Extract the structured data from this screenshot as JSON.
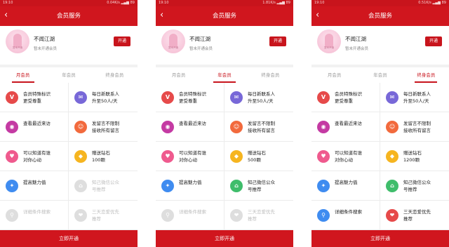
{
  "colors": {
    "brand": "#c8141c",
    "ic_red": "#e64a4a",
    "ic_purple": "#7868d8",
    "ic_magenta": "#c43aa3",
    "ic_orange": "#f26a3d",
    "ic_pink": "#ef5a8e",
    "ic_yellow": "#f6b520",
    "ic_blue": "#3f8cf0",
    "ic_green": "#3fbd6b"
  },
  "screens": [
    {
      "status": {
        "time": "19:10",
        "net": "0.04K/s",
        "battery": "89"
      },
      "title": "会员服务",
      "profile": {
        "name": "不闻江湖",
        "status": "暂未开通会员",
        "open": "开通",
        "avatar_text": "暂未开通"
      },
      "tabs": [
        "月会员",
        "年会员",
        "终身会员"
      ],
      "active_tab": 0,
      "features": [
        {
          "icon": "vip-v-icon",
          "glyph": "V",
          "label": [
            "会员特殊标识",
            "更受尊重"
          ]
        },
        {
          "icon": "mail-icon",
          "glyph": "✉",
          "label": [
            "每日新联系人",
            "升至50人/天"
          ]
        },
        {
          "icon": "eye-icon",
          "glyph": "◉",
          "label": [
            "查看最近来访",
            ""
          ]
        },
        {
          "icon": "message-icon",
          "glyph": "☺",
          "label": [
            "发留言不限制",
            "接收所有留言"
          ]
        },
        {
          "icon": "heart-icon",
          "glyph": "♥",
          "label": [
            "可以知道有谁",
            "对你心动"
          ]
        },
        {
          "icon": "diamond-icon",
          "glyph": "◆",
          "label": [
            "赠送钻石",
            "100颗"
          ]
        },
        {
          "icon": "charm-icon",
          "glyph": "✦",
          "label": [
            "提高魅力值",
            ""
          ]
        },
        {
          "icon": "wechat-icon",
          "glyph": "⌂",
          "label": [
            "知己微信公众",
            "号推荐"
          ]
        },
        {
          "icon": "search-icon",
          "glyph": "⚲",
          "label": [
            "详细条件搜索",
            ""
          ]
        },
        {
          "icon": "love-icon",
          "glyph": "❤",
          "label": [
            "三天恋爱优先",
            "推荐"
          ]
        }
      ],
      "dimmed": [
        7,
        8,
        9
      ],
      "cta": "立即开通"
    },
    {
      "status": {
        "time": "19:10",
        "net": "1.81K/s",
        "battery": "89"
      },
      "title": "会员服务",
      "profile": {
        "name": "不闻江湖",
        "status": "暂未开通会员",
        "open": "开通",
        "avatar_text": "暂未开通"
      },
      "tabs": [
        "月会员",
        "年会员",
        "终身会员"
      ],
      "active_tab": 1,
      "features": [
        {
          "icon": "vip-v-icon",
          "glyph": "V",
          "label": [
            "会员特殊标识",
            "更受尊重"
          ]
        },
        {
          "icon": "mail-icon",
          "glyph": "✉",
          "label": [
            "每日新联系人",
            "升至50人/天"
          ]
        },
        {
          "icon": "eye-icon",
          "glyph": "◉",
          "label": [
            "查看最近来访",
            ""
          ]
        },
        {
          "icon": "message-icon",
          "glyph": "☺",
          "label": [
            "发留言不限制",
            "接收所有留言"
          ]
        },
        {
          "icon": "heart-icon",
          "glyph": "♥",
          "label": [
            "可以知道有谁",
            "对你心动"
          ]
        },
        {
          "icon": "diamond-icon",
          "glyph": "◆",
          "label": [
            "赠送钻石",
            "500颗"
          ]
        },
        {
          "icon": "charm-icon",
          "glyph": "✦",
          "label": [
            "提高魅力值",
            ""
          ]
        },
        {
          "icon": "wechat-icon",
          "glyph": "⌂",
          "label": [
            "知己微信公众",
            "号推荐"
          ]
        },
        {
          "icon": "search-icon",
          "glyph": "⚲",
          "label": [
            "详细条件搜索",
            ""
          ]
        },
        {
          "icon": "love-icon",
          "glyph": "❤",
          "label": [
            "三天恋爱优先",
            "推荐"
          ]
        }
      ],
      "dimmed": [
        8,
        9
      ],
      "cta": "立即开通"
    },
    {
      "status": {
        "time": "19:10",
        "net": "0.51K/s",
        "battery": "89"
      },
      "title": "会员服务",
      "profile": {
        "name": "不闻江湖",
        "status": "暂未开通会员",
        "open": "开通",
        "avatar_text": "暂未开通"
      },
      "tabs": [
        "月会员",
        "年会员",
        "终身会员"
      ],
      "active_tab": 2,
      "features": [
        {
          "icon": "vip-v-icon",
          "glyph": "V",
          "label": [
            "会员特殊标识",
            "更受尊重"
          ]
        },
        {
          "icon": "mail-icon",
          "glyph": "✉",
          "label": [
            "每日新联系人",
            "升至50人/天"
          ]
        },
        {
          "icon": "eye-icon",
          "glyph": "◉",
          "label": [
            "查看最近来访",
            ""
          ]
        },
        {
          "icon": "message-icon",
          "glyph": "☺",
          "label": [
            "发留言不限制",
            "接收所有留言"
          ]
        },
        {
          "icon": "heart-icon",
          "glyph": "♥",
          "label": [
            "可以知道有谁",
            "对你心动"
          ]
        },
        {
          "icon": "diamond-icon",
          "glyph": "◆",
          "label": [
            "赠送钻石",
            "1200颗"
          ]
        },
        {
          "icon": "charm-icon",
          "glyph": "✦",
          "label": [
            "提高魅力值",
            ""
          ]
        },
        {
          "icon": "wechat-icon",
          "glyph": "⌂",
          "label": [
            "知己微信公众",
            "号推荐"
          ]
        },
        {
          "icon": "search-icon",
          "glyph": "⚲",
          "label": [
            "详细条件搜索",
            ""
          ]
        },
        {
          "icon": "love-icon",
          "glyph": "❤",
          "label": [
            "三天恋爱优先",
            "推荐"
          ]
        }
      ],
      "dimmed": [],
      "cta": "立即开通"
    }
  ]
}
